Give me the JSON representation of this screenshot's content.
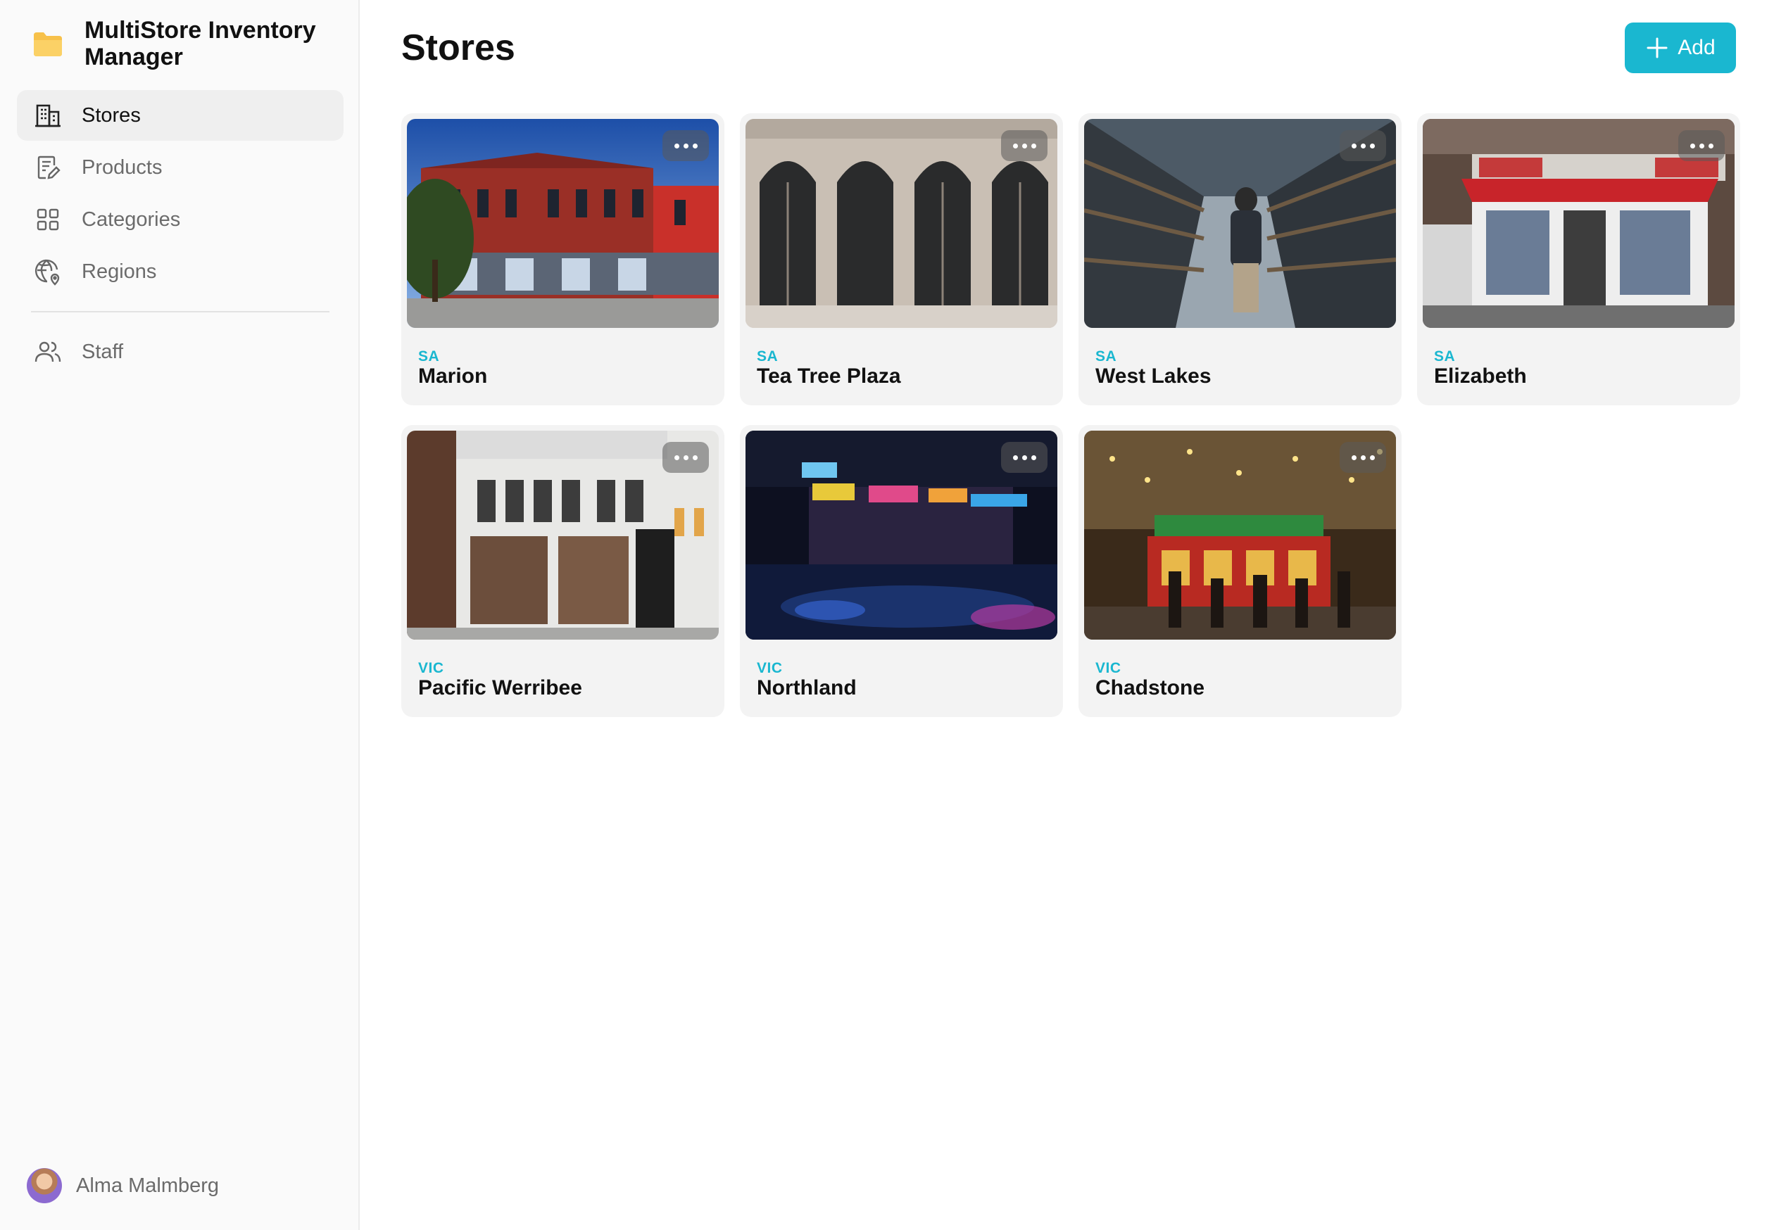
{
  "app": {
    "title": "MultiStore Inventory Manager",
    "accent_color": "#1ab7d0",
    "brand_icon": "folder-icon"
  },
  "sidebar": {
    "items": [
      {
        "label": "Stores",
        "icon": "building-icon",
        "active": true
      },
      {
        "label": "Products",
        "icon": "document-edit-icon",
        "active": false
      },
      {
        "label": "Categories",
        "icon": "grid-icon",
        "active": false
      },
      {
        "label": "Regions",
        "icon": "globe-pin-icon",
        "active": false
      },
      {
        "label": "Staff",
        "icon": "users-icon",
        "active": false
      }
    ],
    "user": {
      "name": "Alma Malmberg"
    }
  },
  "main": {
    "title": "Stores",
    "add_label": "Add",
    "stores": [
      {
        "region": "SA",
        "name": "Marion",
        "image": "red-brick-building-photo"
      },
      {
        "region": "SA",
        "name": "Tea Tree Plaza",
        "image": "arched-storefront-photo"
      },
      {
        "region": "SA",
        "name": "West Lakes",
        "image": "warehouse-aisle-photo"
      },
      {
        "region": "SA",
        "name": "Elizabeth",
        "image": "newsagent-shopfront-photo"
      },
      {
        "region": "VIC",
        "name": "Pacific Werribee",
        "image": "white-shopfront-photo"
      },
      {
        "region": "VIC",
        "name": "Northland",
        "image": "neon-street-night-photo"
      },
      {
        "region": "VIC",
        "name": "Chadstone",
        "image": "festive-pub-night-photo"
      }
    ]
  }
}
